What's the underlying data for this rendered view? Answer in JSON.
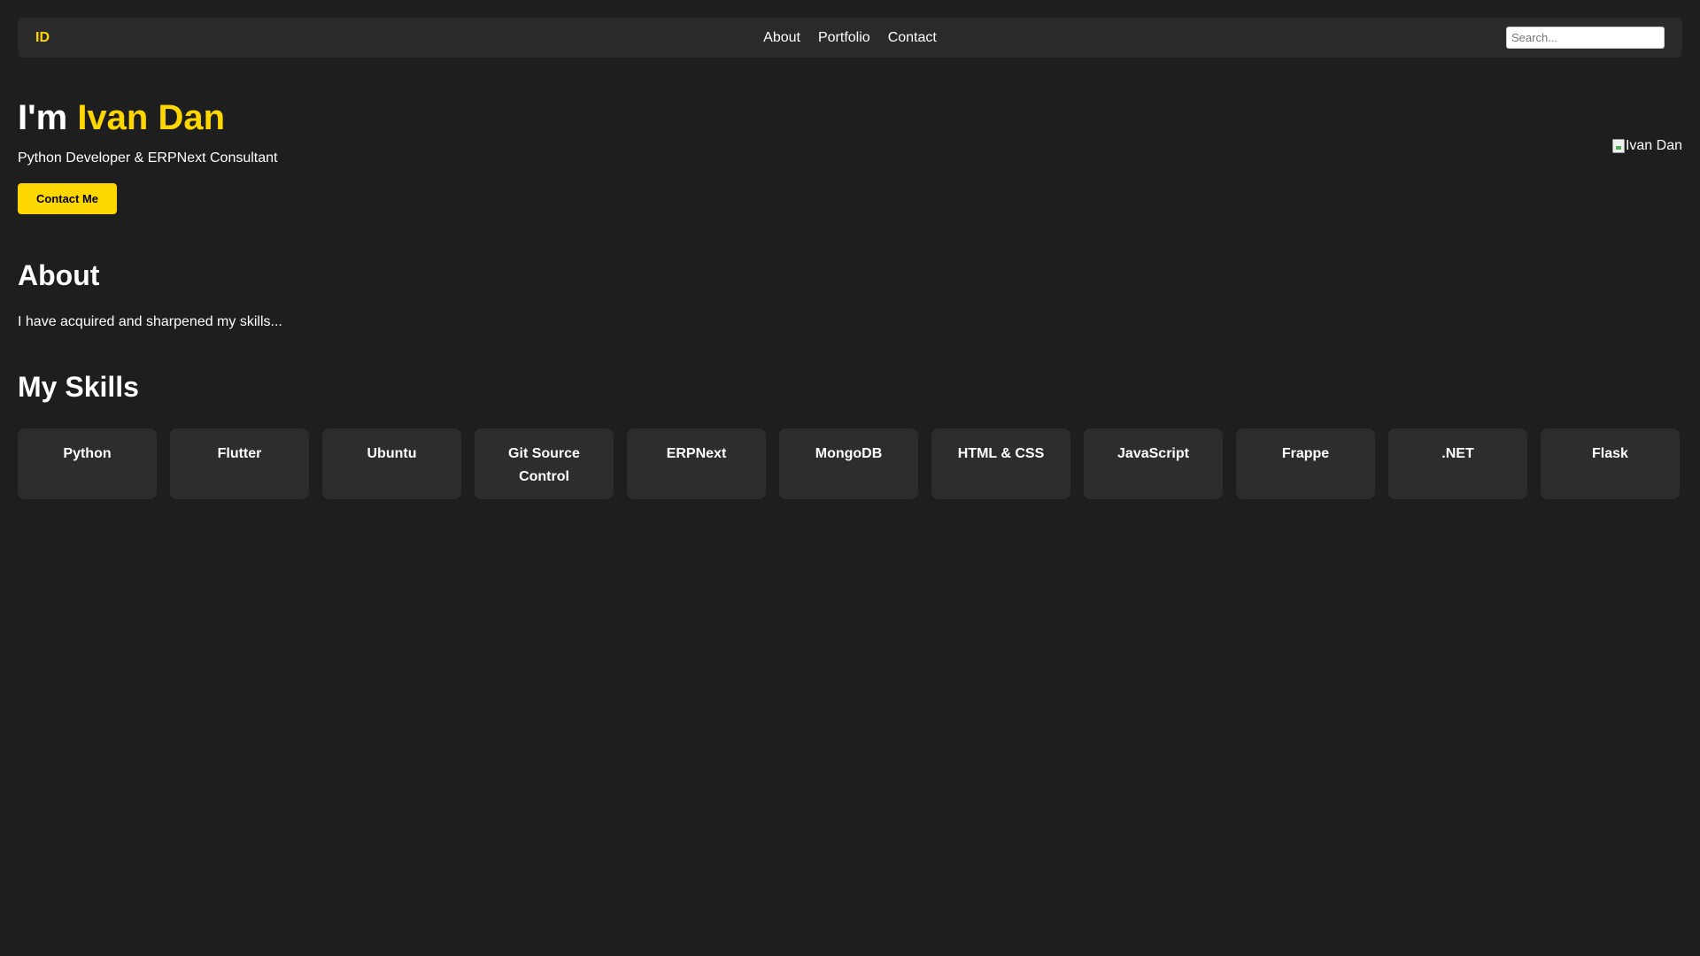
{
  "navbar": {
    "logo": "ID",
    "links": [
      "About",
      "Portfolio",
      "Contact"
    ],
    "search_placeholder": "Search..."
  },
  "hero": {
    "greeting": "I'm ",
    "name": "Ivan Dan",
    "subtitle": "Python Developer & ERPNext Consultant",
    "cta_label": "Contact Me",
    "image_alt": "Ivan Dan"
  },
  "about": {
    "title": "About",
    "text": "I have acquired and sharpened my skills..."
  },
  "skills": {
    "title": "My Skills",
    "items": [
      "Python",
      "Flutter",
      "Ubuntu",
      "Git Source Control",
      "ERPNext",
      "MongoDB",
      "HTML & CSS",
      "JavaScript",
      "Frappe",
      ".NET",
      "Flask"
    ]
  },
  "colors": {
    "background": "#1e1e1e",
    "surface": "#2a2a2a",
    "card": "#2d2d2d",
    "accent": "#ffd700",
    "text": "#ffffff"
  }
}
